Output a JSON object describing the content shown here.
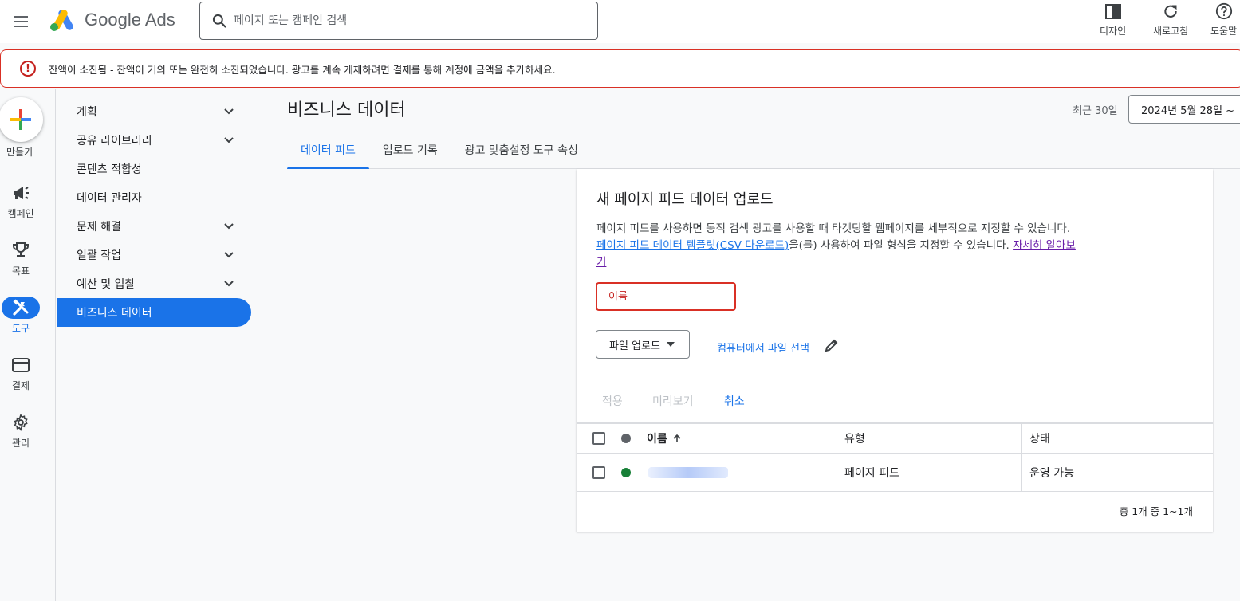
{
  "header": {
    "app_name": "Google Ads",
    "search_placeholder": "페이지 또는 캠페인 검색",
    "actions": [
      {
        "label": "디자인",
        "icon": "appearance-icon"
      },
      {
        "label": "새로고침",
        "icon": "refresh-icon"
      },
      {
        "label": "도움말",
        "icon": "help-icon"
      }
    ]
  },
  "alert": {
    "text": "잔액이 소진됨 - 잔액이 거의 또는 완전히 소진되었습니다. 광고를 계속 게재하려면 결제를 통해 계정에 금액을 추가하세요.",
    "color": "#d93025"
  },
  "rail": {
    "create_label": "만들기",
    "items": [
      {
        "label": "캠페인",
        "icon": "megaphone-icon"
      },
      {
        "label": "목표",
        "icon": "trophy-icon"
      },
      {
        "label": "도구",
        "icon": "tools-icon",
        "active": true
      },
      {
        "label": "결제",
        "icon": "credit-card-icon"
      },
      {
        "label": "관리",
        "icon": "gear-icon"
      }
    ]
  },
  "subnav": {
    "items": [
      {
        "label": "계획",
        "expandable": true
      },
      {
        "label": "공유 라이브러리",
        "expandable": true
      },
      {
        "label": "콘텐츠 적합성",
        "expandable": false
      },
      {
        "label": "데이터 관리자",
        "expandable": false
      },
      {
        "label": "문제 해결",
        "expandable": true
      },
      {
        "label": "일괄 작업",
        "expandable": true
      },
      {
        "label": "예산 및 입찰",
        "expandable": true
      },
      {
        "label": "비즈니스 데이터",
        "expandable": false,
        "active": true
      }
    ]
  },
  "main": {
    "title": "비즈니스 데이터",
    "date_range_label": "최근 30일",
    "date_range_value": "2024년 5월 28일 ~",
    "tabs": [
      {
        "label": "데이터 피드",
        "active": true
      },
      {
        "label": "업로드 기록",
        "active": false
      },
      {
        "label": "광고 맞춤설정 도구 속성",
        "active": false
      }
    ]
  },
  "upload_card": {
    "title": "새 페이지 피드 데이터 업로드",
    "desc_part1": "페이지 피드를 사용하면 동적 검색 광고를 사용할 때 타겟팅할 웹페이지를 세부적으로 지정할 수 있습니다. ",
    "template_link": "페이지 피드 데이터 템플릿(CSV 다운로드)",
    "desc_part2": "을(를) 사용하여 파일 형식을 지정할 수 있습니다. ",
    "learn_more_link": "자세히 알아보기",
    "name_placeholder": "이름",
    "upload_dropdown": "파일 업로드",
    "choose_file": "컴퓨터에서 파일 선택",
    "apply": "적용",
    "preview": "미리보기",
    "cancel": "취소"
  },
  "table": {
    "columns": [
      "이름",
      "유형",
      "상태"
    ],
    "rows": [
      {
        "type": "페이지 피드",
        "status": "운영 가능",
        "status_color": "#188038"
      }
    ],
    "pagination": "총 1개 중 1~1개"
  },
  "colors": {
    "accent": "#1a73e8",
    "error": "#d93025",
    "success": "#188038"
  }
}
